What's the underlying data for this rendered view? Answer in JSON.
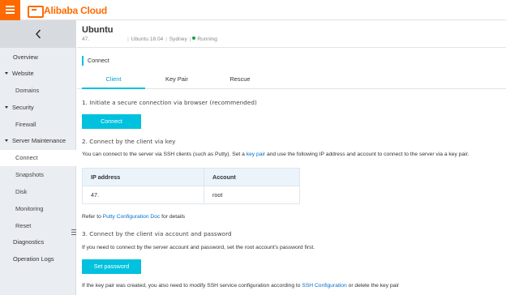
{
  "topbar": {
    "brand": "Alibaba Cloud"
  },
  "sidebar": {
    "items": [
      {
        "label": "Overview"
      },
      {
        "label": "Website"
      },
      {
        "label": "Domains"
      },
      {
        "label": "Security"
      },
      {
        "label": "Firewall"
      },
      {
        "label": "Server Maintenance"
      },
      {
        "label": "Connect"
      },
      {
        "label": "Snapshots"
      },
      {
        "label": "Disk"
      },
      {
        "label": "Monitoring"
      },
      {
        "label": "Reset"
      },
      {
        "label": "Diagnostics"
      },
      {
        "label": "Operation Logs"
      }
    ]
  },
  "instance": {
    "name": "Ubuntu",
    "ip": "47.",
    "os": "Ubuntu 18.04",
    "region": "Sydney",
    "status": "Running"
  },
  "section": {
    "title": "Connect"
  },
  "tabs": [
    {
      "label": "Client"
    },
    {
      "label": "Key Pair"
    },
    {
      "label": "Rescue"
    }
  ],
  "content": {
    "step1": "1. Initiate a secure connection via browser (recommended)",
    "connect_button": "Connect",
    "step2": "2. Connect by the client via key",
    "step2_desc_before": "You can connect to the server via SSH clients (such as Putty). Set a ",
    "step2_desc_link": "key pair",
    "step2_desc_after": " and use the following IP address and account to connect to the server via a key pair.",
    "table": {
      "headers": [
        "IP address",
        "Account"
      ],
      "row": [
        "47.",
        "root"
      ]
    },
    "refer_before": "Refer to ",
    "refer_link": "Putty Configuration Doc",
    "refer_after": " for details",
    "step3": "3. Connect by the client via account and password",
    "step3_desc": "If you need to connect by the server account and password, set the root account's password first.",
    "set_password_button": "Set password",
    "footer_before": "If the key pair was created, you also need to modify SSH service configuration according to ",
    "footer_link": "SSH Configuration",
    "footer_after": " or delete the key pair"
  }
}
